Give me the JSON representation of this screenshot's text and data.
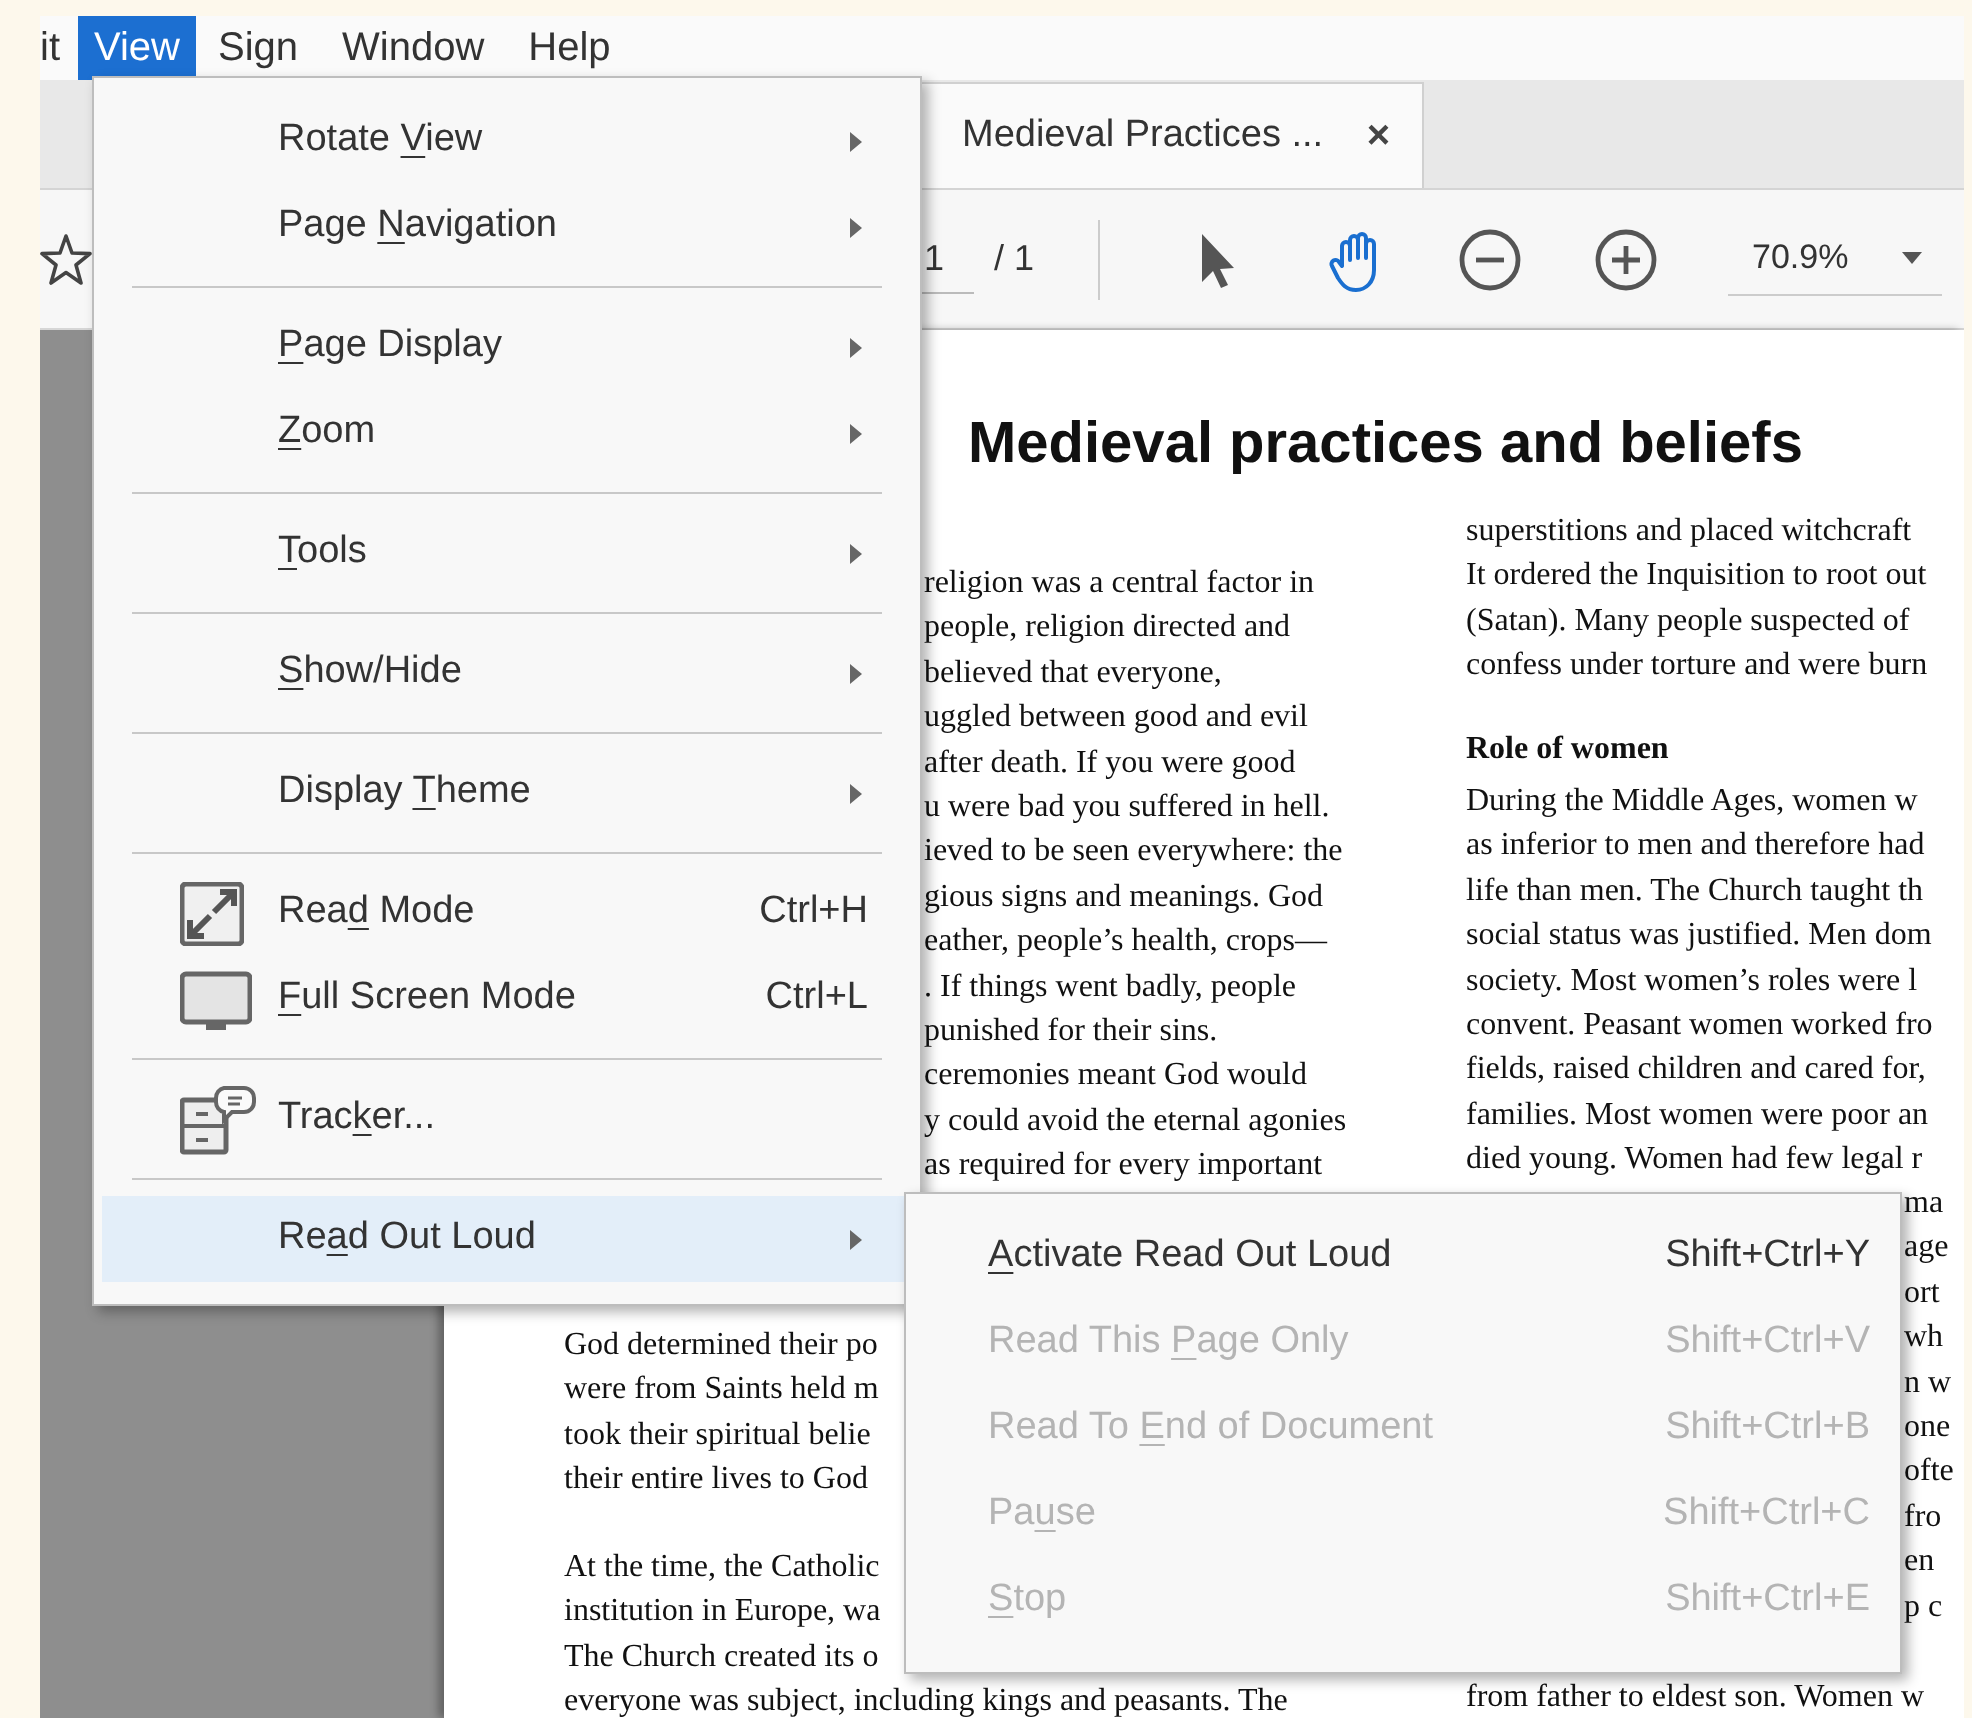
{
  "menu_bar": [
    {
      "label": "it",
      "selected": false
    },
    {
      "label": "View",
      "selected": true
    },
    {
      "label": "Sign",
      "selected": false
    },
    {
      "label": "Window",
      "selected": false
    },
    {
      "label": "Help",
      "selected": false
    }
  ],
  "tab": {
    "title": "Medieval Practices ...",
    "close": "×"
  },
  "toolbar": {
    "page": "1",
    "page_total": "/ 1",
    "tools": [
      {
        "kind": "select",
        "selected": false
      },
      {
        "kind": "hand",
        "selected": true
      },
      {
        "kind": "zoom_out",
        "selected": false
      },
      {
        "kind": "zoom_in",
        "selected": false
      }
    ],
    "zoom": "70.9%"
  },
  "document": {
    "title": "Medieval practices and beliefs",
    "left_fragments": [
      "religion was a central factor in",
      "people, religion directed and",
      "believed that everyone,",
      "uggled between good and evil",
      "after death. If you were good",
      "u were bad you suffered in hell.",
      "ieved to be seen everywhere: the",
      "gious signs and meanings. God",
      "eather, people’s health, crops—",
      ". If things went badly, people",
      "punished for their sins.",
      "ceremonies meant God would",
      "y could avoid the eternal agonies",
      "as required for every important"
    ],
    "left_lines": [
      "God determined their po",
      "were from Saints held m",
      "took their spiritual belie",
      "their entire lives to God"
    ],
    "left_lines_2": [
      "At the time, the Catholic",
      "institution in Europe, wa",
      "The Church created its o",
      "everyone was subject, including kings and peasants. The"
    ],
    "right_lines": [
      "superstitions and placed witchcraft",
      "It ordered the Inquisition to root out",
      "(Satan). Many people suspected of",
      "confess under torture and were burn"
    ],
    "right_heading": "Role of women",
    "right_paragraph": [
      "During the Middle Ages, women w",
      "as inferior to men and therefore had",
      "life than men. The Church taught th",
      "social status was justified. Men dom",
      "society. Most women’s roles were l",
      "convent. Peasant women worked fro",
      "fields, raised children and cared for,",
      "families. Most women were poor an",
      "died young. Women had few legal r"
    ],
    "right_fragments": [
      "ma",
      "age",
      "ort",
      "wh",
      "n w",
      "one",
      "ofte",
      "fro",
      "en",
      "p c"
    ],
    "right_last_line": "from father to eldest son. Women w"
  },
  "view_menu": [
    {
      "kind": "item",
      "label_parts": [
        "Rotate ",
        "V",
        "iew"
      ],
      "submenu": true,
      "highlighted": false
    },
    {
      "kind": "item",
      "label_parts": [
        "Page ",
        "N",
        "avigation"
      ],
      "submenu": true,
      "highlighted": false
    },
    {
      "kind": "separator"
    },
    {
      "kind": "item",
      "label_parts": [
        "P",
        "age Display"
      ],
      "submenu": true,
      "highlighted": false
    },
    {
      "kind": "item",
      "label_parts": [
        "Z",
        "oom"
      ],
      "submenu": true,
      "highlighted": false
    },
    {
      "kind": "separator"
    },
    {
      "kind": "item",
      "label_parts": [
        "T",
        "ools"
      ],
      "submenu": true,
      "highlighted": false
    },
    {
      "kind": "separator"
    },
    {
      "kind": "item",
      "label_parts": [
        "S",
        "how/Hide"
      ],
      "submenu": true,
      "highlighted": false
    },
    {
      "kind": "separator"
    },
    {
      "kind": "item",
      "label_parts": [
        "Display ",
        "T",
        "heme"
      ],
      "submenu": true,
      "highlighted": false
    },
    {
      "kind": "separator"
    },
    {
      "kind": "item",
      "label_parts": [
        "Rea",
        "d",
        " Mode"
      ],
      "shortcut": "Ctrl+H",
      "submenu": false,
      "highlighted": false
    },
    {
      "kind": "item",
      "label_parts": [
        "F",
        "ull Screen Mode"
      ],
      "shortcut": "Ctrl+L",
      "submenu": false,
      "highlighted": false
    },
    {
      "kind": "separator"
    },
    {
      "kind": "item",
      "label_parts": [
        "Trac",
        "k",
        "er..."
      ],
      "submenu": false,
      "highlighted": false
    },
    {
      "kind": "separator"
    },
    {
      "kind": "item",
      "label_parts": [
        "Re",
        "a",
        "d Out Loud"
      ],
      "submenu": true,
      "highlighted": true
    }
  ],
  "read_out_loud_menu": [
    {
      "label_parts": [
        "A",
        "ctivate Read Out Loud"
      ],
      "shortcut": "Shift+Ctrl+Y",
      "disabled": false
    },
    {
      "label_parts": [
        "Read This ",
        "P",
        "age Only"
      ],
      "shortcut": "Shift+Ctrl+V",
      "disabled": true
    },
    {
      "label_parts": [
        "Read To ",
        "E",
        "nd of Document"
      ],
      "shortcut": "Shift+Ctrl+B",
      "disabled": true
    },
    {
      "label_parts": [
        "Pa",
        "u",
        "se"
      ],
      "shortcut": "Shift+Ctrl+C",
      "disabled": true
    },
    {
      "label_parts": [
        "S",
        "top"
      ],
      "shortcut": "Shift+Ctrl+E",
      "disabled": true
    }
  ]
}
